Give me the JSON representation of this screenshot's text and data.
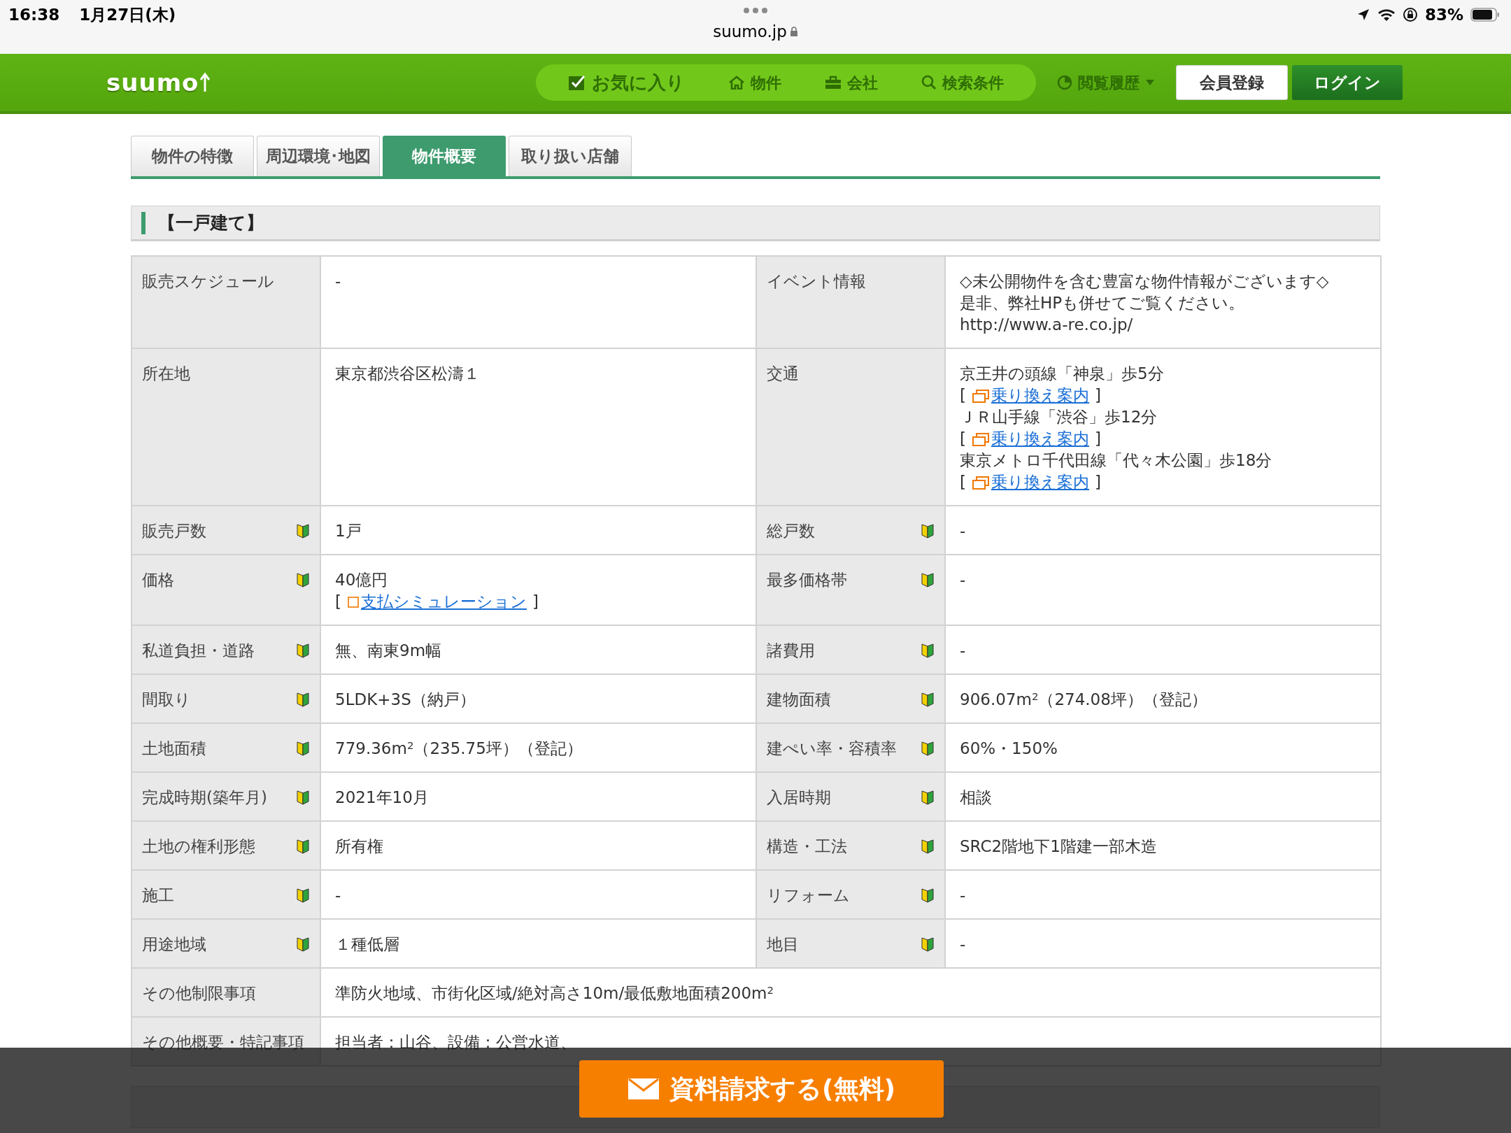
{
  "status_bar": {
    "time": "16:38",
    "date": "1月27日(木)",
    "battery": "83%"
  },
  "browser": {
    "url": "suumo.jp"
  },
  "header": {
    "logo": "suumo",
    "nav": [
      {
        "label": "お気に入り",
        "kind": "favorite"
      },
      {
        "label": "物件",
        "kind": "property"
      },
      {
        "label": "会社",
        "kind": "company"
      },
      {
        "label": "検索条件",
        "kind": "search"
      }
    ],
    "history": "閲覧履歴",
    "register": "会員登録",
    "login": "ログイン"
  },
  "tabs": [
    {
      "label": "物件の特徴",
      "selected": false
    },
    {
      "label": "周辺環境･地図",
      "selected": false
    },
    {
      "label": "物件概要",
      "selected": true
    },
    {
      "label": "取り扱い店舗",
      "selected": false
    }
  ],
  "section": {
    "title": "【一戸建て】"
  },
  "table": {
    "rows": [
      {
        "cells": [
          {
            "label": "販売スケジュール",
            "help": false,
            "lines": [
              {
                "kind": "text",
                "text": "-"
              }
            ]
          },
          {
            "label": "イベント情報",
            "help": false,
            "lines": [
              {
                "kind": "text",
                "text": "◇未公開物件を含む豊富な物件情報がございます◇"
              },
              {
                "kind": "text",
                "text": "是非、弊社HPも併せてご覧ください。"
              },
              {
                "kind": "text",
                "text": "http://www.a-re.co.jp/"
              }
            ]
          }
        ]
      },
      {
        "cells": [
          {
            "label": "所在地",
            "help": false,
            "lines": [
              {
                "kind": "text",
                "text": "東京都渋谷区松濤１"
              }
            ]
          },
          {
            "label": "交通",
            "help": false,
            "lines": [
              {
                "kind": "text",
                "text": "京王井の頭線「神泉」歩5分"
              },
              {
                "kind": "route-link",
                "before": "[",
                "text": "乗り換え案内",
                "after": "]"
              },
              {
                "kind": "text",
                "text": "ＪＲ山手線「渋谷」歩12分"
              },
              {
                "kind": "route-link",
                "before": "[",
                "text": "乗り換え案内",
                "after": "]"
              },
              {
                "kind": "text",
                "text": "東京メトロ千代田線「代々木公園」歩18分"
              },
              {
                "kind": "route-link",
                "before": "[",
                "text": "乗り換え案内",
                "after": "]"
              }
            ]
          }
        ]
      },
      {
        "cells": [
          {
            "label": "販売戸数",
            "help": true,
            "lines": [
              {
                "kind": "text",
                "text": "1戸"
              }
            ]
          },
          {
            "label": "総戸数",
            "help": true,
            "lines": [
              {
                "kind": "text",
                "text": "-"
              }
            ]
          }
        ]
      },
      {
        "cells": [
          {
            "label": "価格",
            "help": true,
            "lines": [
              {
                "kind": "text",
                "text": "40億円"
              },
              {
                "kind": "sim-link",
                "before": "[",
                "text": "支払シミュレーション",
                "after": "]"
              }
            ]
          },
          {
            "label": "最多価格帯",
            "help": true,
            "lines": [
              {
                "kind": "text",
                "text": "-"
              }
            ]
          }
        ]
      },
      {
        "cells": [
          {
            "label": "私道負担・道路",
            "help": true,
            "lines": [
              {
                "kind": "text",
                "text": "無、南東9m幅"
              }
            ]
          },
          {
            "label": "諸費用",
            "help": true,
            "lines": [
              {
                "kind": "text",
                "text": "-"
              }
            ]
          }
        ]
      },
      {
        "cells": [
          {
            "label": "間取り",
            "help": true,
            "lines": [
              {
                "kind": "text",
                "text": "5LDK+3S（納戸）"
              }
            ]
          },
          {
            "label": "建物面積",
            "help": true,
            "lines": [
              {
                "kind": "text",
                "text": "906.07m$^{2}$（274.08坪）（登記）"
              }
            ]
          }
        ]
      },
      {
        "cells": [
          {
            "label": "土地面積",
            "help": true,
            "lines": [
              {
                "kind": "text",
                "text": "779.36m$^{2}$（235.75坪）（登記）"
              }
            ]
          },
          {
            "label": "建ぺい率・容積率",
            "help": true,
            "lines": [
              {
                "kind": "text",
                "text": "60%・150%"
              }
            ]
          }
        ]
      },
      {
        "cells": [
          {
            "label": "完成時期(築年月)",
            "help": true,
            "lines": [
              {
                "kind": "text",
                "text": "2021年10月"
              }
            ]
          },
          {
            "label": "入居時期",
            "help": true,
            "lines": [
              {
                "kind": "text",
                "text": "相談"
              }
            ]
          }
        ]
      },
      {
        "cells": [
          {
            "label": "土地の権利形態",
            "help": true,
            "lines": [
              {
                "kind": "text",
                "text": "所有権"
              }
            ]
          },
          {
            "label": "構造・工法",
            "help": true,
            "lines": [
              {
                "kind": "text",
                "text": "SRC2階地下1階建一部木造"
              }
            ]
          }
        ]
      },
      {
        "cells": [
          {
            "label": "施工",
            "help": true,
            "lines": [
              {
                "kind": "text",
                "text": "-"
              }
            ]
          },
          {
            "label": "リフォーム",
            "help": true,
            "lines": [
              {
                "kind": "text",
                "text": "-"
              }
            ]
          }
        ]
      },
      {
        "cells": [
          {
            "label": "用途地域",
            "help": true,
            "lines": [
              {
                "kind": "text",
                "text": "１種低層"
              }
            ]
          },
          {
            "label": "地目",
            "help": true,
            "lines": [
              {
                "kind": "text",
                "text": "-"
              }
            ]
          }
        ]
      },
      {
        "cells": [
          {
            "label": "その他制限事項",
            "help": false,
            "lines": [
              {
                "kind": "text",
                "text": "準防火地域、市街化区域/絶対高さ10m/最低敷地面積200m$^{2}$"
              }
            ]
          }
        ]
      },
      {
        "cells": [
          {
            "label": "その他概要・特記事項",
            "help": false,
            "lines": [
              {
                "kind": "text",
                "text": "担当者：山谷、設備：公営水道、"
              }
            ]
          }
        ]
      }
    ]
  },
  "cta": {
    "label": "資料請求する(無料)"
  }
}
